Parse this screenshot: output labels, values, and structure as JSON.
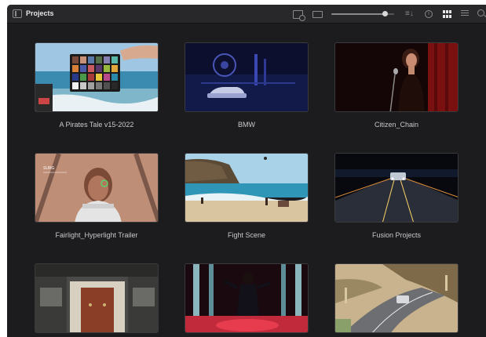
{
  "window": {
    "title": "Projects"
  },
  "toolbar": {
    "icons": [
      "sidebar-toggle-icon",
      "new-folder-icon",
      "display-icon",
      "zoom-slider",
      "sort-icon",
      "info-icon",
      "grid-view-icon",
      "list-view-icon",
      "search-icon"
    ],
    "zoom_level": 0.85
  },
  "projects": [
    {
      "name": "A Pirates Tale v15-2022",
      "thumb": "beach-color-chart"
    },
    {
      "name": "BMW",
      "thumb": "blue-night-car"
    },
    {
      "name": "Citizen_Chain",
      "thumb": "singer-red-curtain"
    },
    {
      "name": "Fairlight_Hyperlight Trailer",
      "thumb": "face-hud"
    },
    {
      "name": "Fight Scene",
      "thumb": "beach-cliffs"
    },
    {
      "name": "Fusion Projects",
      "thumb": "night-road-car"
    },
    {
      "name": "",
      "thumb": "storefront-door"
    },
    {
      "name": "",
      "thumb": "neon-dancer"
    },
    {
      "name": "",
      "thumb": "coastal-road-car"
    }
  ],
  "colors": {
    "window_bg": "#1c1c1e",
    "titlebar_bg": "#28282a",
    "label_text": "#c8c8c8"
  }
}
